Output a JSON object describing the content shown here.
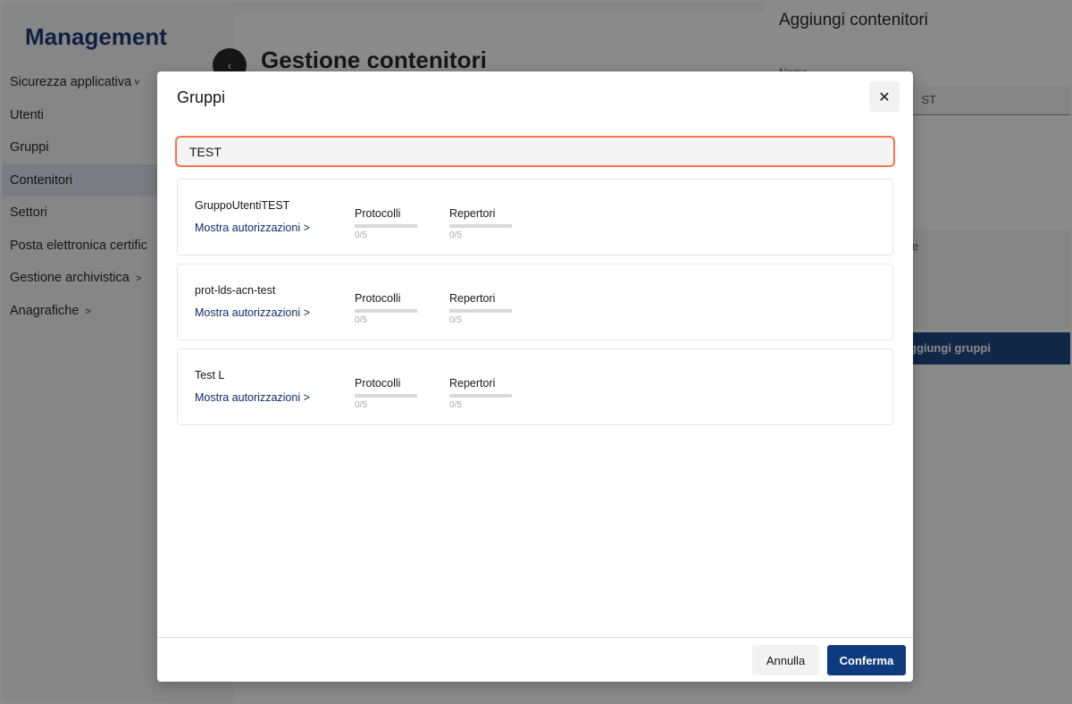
{
  "app": {
    "brand": "Management",
    "nav": [
      {
        "label": "Sicurezza applicativa",
        "chevron": "˅"
      },
      {
        "label": "Utenti",
        "chevron": ""
      },
      {
        "label": "Gruppi",
        "chevron": ""
      },
      {
        "label": "Contenitori",
        "chevron": "",
        "active": true
      },
      {
        "label": "Settori",
        "chevron": ""
      },
      {
        "label": "Posta elettronica certific",
        "chevron": ""
      },
      {
        "label": "Gestione archivistica",
        "chevron": ">"
      },
      {
        "label": "Anagrafiche",
        "chevron": ">"
      }
    ],
    "back_icon": "‹",
    "page_title": "Gestione contenitori"
  },
  "side_panel": {
    "title": "Aggiungi contenitori",
    "name_label": "Nome",
    "name_value_fragment": "ST",
    "box_label_fragment": "le",
    "add_groups_button_fragment": "ggiungi gruppi"
  },
  "modal": {
    "title": "Gruppi",
    "close_icon": "✕",
    "search": {
      "value": "TEST",
      "placeholder": ""
    },
    "stat_labels": {
      "protocolli": "Protocolli",
      "repertori": "Repertori"
    },
    "groups": [
      {
        "name": "GruppoUtentiTEST",
        "link": "Mostra autorizzazioni >",
        "protocolli_count": "0/5",
        "protocolli_fraction": 0,
        "repertori_count": "0/5",
        "repertori_fraction": 0
      },
      {
        "name": "prot-lds-acn-test",
        "link": "Mostra autorizzazioni >",
        "protocolli_count": "0/5",
        "protocolli_fraction": 0,
        "repertori_count": "0/5",
        "repertori_fraction": 0
      },
      {
        "name": "Test L",
        "link": "Mostra autorizzazioni >",
        "protocolli_count": "0/5",
        "protocolli_fraction": 0,
        "repertori_count": "0/5",
        "repertori_fraction": 0
      }
    ],
    "cancel_label": "Annulla",
    "confirm_label": "Conferma"
  },
  "colors": {
    "accent": "#0f3a7d",
    "brand": "#0f2b6b",
    "focus_outline": "#f0764b"
  }
}
